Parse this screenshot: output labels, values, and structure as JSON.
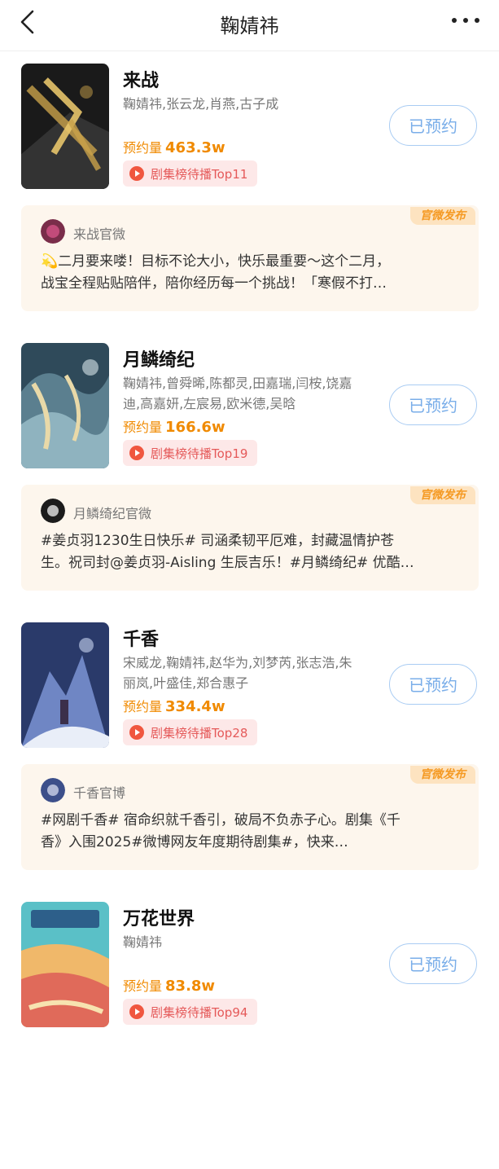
{
  "header": {
    "title": "鞠婧祎"
  },
  "shows": [
    {
      "name": "来战",
      "cast_lines": [
        "鞠婧祎,张云龙,肖燕,古子成",
        ""
      ],
      "reserve_label": "预约量",
      "reserve_value": "463.3w",
      "rank_label": "剧集榜待播Top11",
      "button_label": "已预约",
      "account": "来战官微",
      "tag": "官微发布",
      "post_lines": [
        "💫二月要来喽！目标不论大小，快乐最重要～这个二月，",
        "战宝全程贴贴陪伴，陪你经历每一个挑战！「寒假不打…"
      ]
    },
    {
      "name": "月鳞绮纪",
      "cast_lines": [
        "鞠婧祎,曾舜晞,陈都灵,田嘉瑞,闫桉,饶嘉",
        "迪,高嘉妍,左宸易,欧米德,吴晗"
      ],
      "reserve_label": "预约量",
      "reserve_value": "166.6w",
      "rank_label": "剧集榜待播Top19",
      "button_label": "已预约",
      "account": "月鳞绮纪官微",
      "tag": "官微发布",
      "post_lines": [
        "#姜贞羽1230生日快乐# 司涵柔韧平厄难，封藏温情护苍",
        "生。祝司封@姜贞羽-Aisling 生辰吉乐！#月鳞绮纪# 优酷…"
      ]
    },
    {
      "name": "千香",
      "cast_lines": [
        "宋威龙,鞠婧祎,赵华为,刘梦芮,张志浩,朱",
        "丽岚,叶盛佳,郑合惠子"
      ],
      "reserve_label": "预约量",
      "reserve_value": "334.4w",
      "rank_label": "剧集榜待播Top28",
      "button_label": "已预约",
      "account": "千香官博",
      "tag": "官微发布",
      "post_lines": [
        "#网剧千香# 宿命织就千香引，破局不负赤子心。剧集《千",
        "香》入围2025#微博网友年度期待剧集#，快来…"
      ]
    },
    {
      "name": "万花世界",
      "cast_lines": [
        "鞠婧祎",
        ""
      ],
      "reserve_label": "预约量",
      "reserve_value": "83.8w",
      "rank_label": "剧集榜待播Top94",
      "button_label": "已预约"
    }
  ],
  "colors": {
    "accent_orange": "#f08a00",
    "button_blue": "#7aaee9",
    "rank_red": "#e55a5a",
    "card_bg": "#fdf6ed"
  },
  "icons": {
    "back": "chevron-left-icon",
    "more": "more-dots-icon",
    "rank": "play-circle-icon"
  }
}
